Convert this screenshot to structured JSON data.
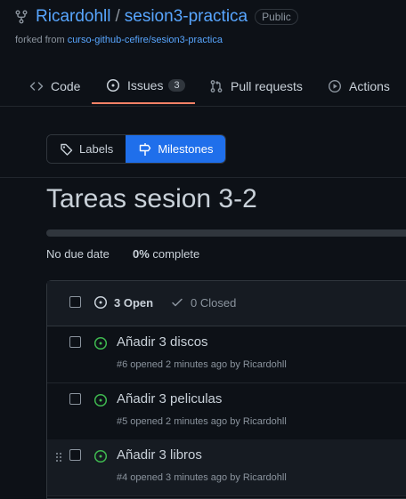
{
  "repo": {
    "owner": "Ricardohll",
    "separator": "/",
    "name": "sesion3-practica",
    "visibility": "Public",
    "forked_prefix": "forked from ",
    "forked_from": "curso-github-cefire/sesion3-practica"
  },
  "tabs": [
    {
      "label": "Code",
      "icon": "code-icon"
    },
    {
      "label": "Issues",
      "icon": "issue-opened-icon",
      "count": "3",
      "active": true
    },
    {
      "label": "Pull requests",
      "icon": "git-pull-request-icon"
    },
    {
      "label": "Actions",
      "icon": "play-icon"
    }
  ],
  "subnav": {
    "labels": "Labels",
    "milestones": "Milestones"
  },
  "milestone": {
    "title": "Tareas sesion 3-2",
    "due": "No due date",
    "percent": "0%",
    "complete_label": "complete",
    "progress": 0
  },
  "issues_header": {
    "open": "3 Open",
    "closed": "0 Closed"
  },
  "issues": [
    {
      "title": "Añadir 3 discos",
      "meta": "#6 opened 2 minutes ago by Ricardohll"
    },
    {
      "title": "Añadir 3 peliculas",
      "meta": "#5 opened 2 minutes ago by Ricardohll"
    },
    {
      "title": "Añadir 3 libros",
      "meta": "#4 opened 3 minutes ago by Ricardohll"
    }
  ],
  "colors": {
    "accent": "#1f6feb",
    "link": "#58a6ff",
    "open": "#3fb950",
    "tab_underline": "#f78166"
  }
}
